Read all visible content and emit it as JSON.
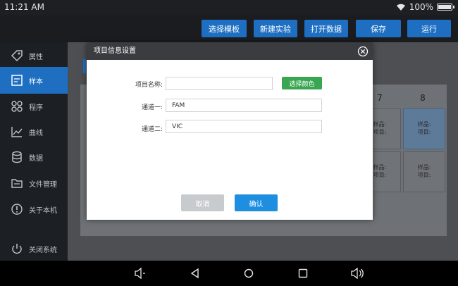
{
  "status": {
    "time": "11:21 AM",
    "battery": "100%"
  },
  "toolbar": {
    "buttons": [
      "选择模板",
      "新建实验",
      "打开数据",
      "保存",
      "运行"
    ]
  },
  "sidebar": {
    "items": [
      {
        "label": "属性",
        "icon": "tag-icon"
      },
      {
        "label": "样本",
        "icon": "document-icon",
        "active": true
      },
      {
        "label": "程序",
        "icon": "grid-icon"
      },
      {
        "label": "曲线",
        "icon": "chart-icon"
      },
      {
        "label": "数据",
        "icon": "database-icon"
      },
      {
        "label": "文件管理",
        "icon": "folder-icon"
      },
      {
        "label": "关于本机",
        "icon": "info-icon"
      },
      {
        "label": "关闭系统",
        "icon": "power-icon"
      }
    ]
  },
  "plate": {
    "columns": [
      "7",
      "8"
    ],
    "wells": [
      {
        "sample": "样品:",
        "project": "项目:"
      },
      {
        "sample": "样品:",
        "project": "项目:",
        "selected": true
      },
      {
        "sample": "样品:",
        "project": "项目:"
      },
      {
        "sample": "样品:",
        "project": "项目:"
      }
    ]
  },
  "dialog": {
    "title": "项目信息设置",
    "project_name_label": "项目名称:",
    "project_name_value": "",
    "choose_color_label": "选择颜色",
    "channel1_label": "通道一:",
    "channel1_value": "FAM",
    "channel2_label": "通道二:",
    "channel2_value": "VIC",
    "cancel_label": "取消",
    "confirm_label": "确认"
  }
}
